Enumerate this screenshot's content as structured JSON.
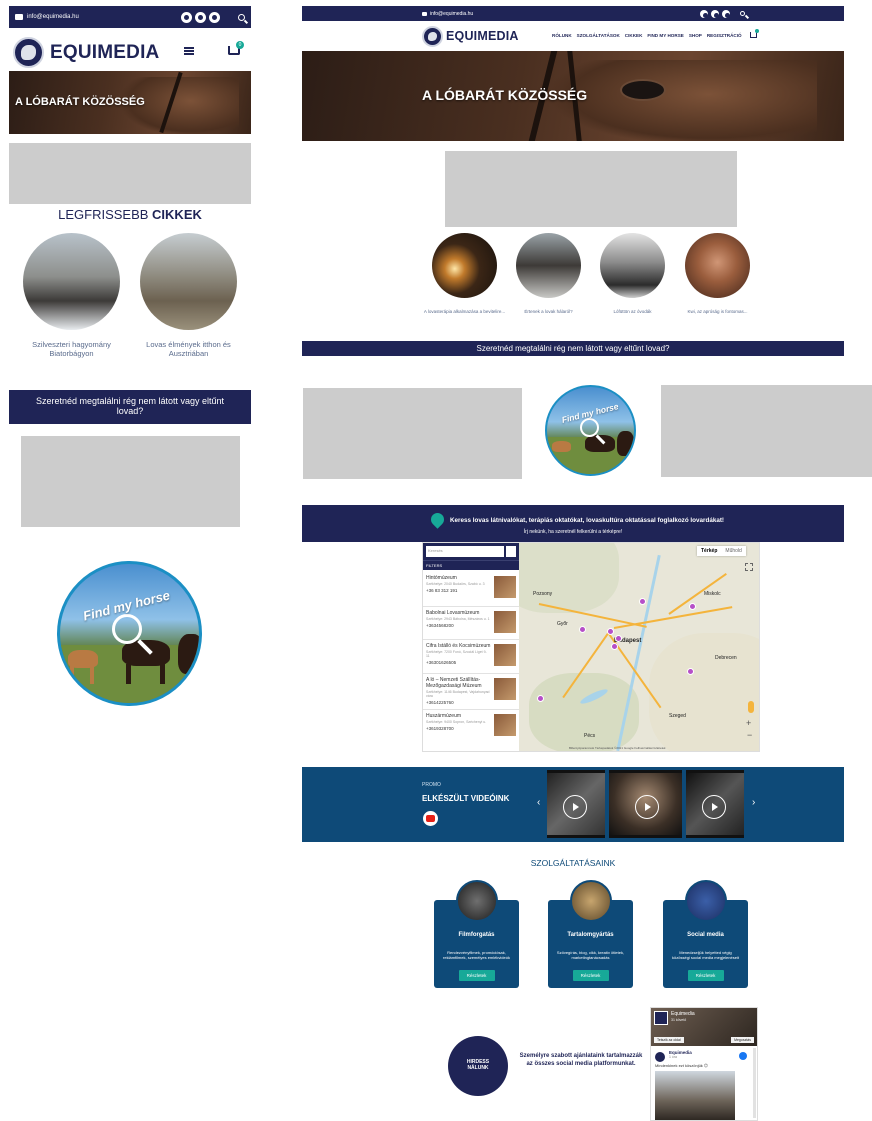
{
  "brand": {
    "email": "info@equimedia.hu",
    "name": "EQUIMEDIA"
  },
  "nav": {
    "items": [
      "RÓLUNK",
      "SZOLGÁLTATÁSOK",
      "CIKKEK",
      "FIND MY HORSE",
      "SHOP",
      "REGISZTRÁCIÓ"
    ],
    "cart_count": "0"
  },
  "hero": {
    "title": "A LÓBARÁT KÖZÖSSÉG"
  },
  "latest": {
    "title_light": "LEGFRISSEBB",
    "title_bold": "CIKKEK"
  },
  "mobile_articles": [
    {
      "caption": "Szilveszteri hagyomány Biatorbágyon"
    },
    {
      "caption": "Lovas élmények itthon és Ausztriában"
    }
  ],
  "desktop_articles": [
    {
      "caption": "A lovasterápia alkalmazása a bevitelire..."
    },
    {
      "caption": "Értenek a lovak hálaról?"
    },
    {
      "caption": "Lófüttön az óvodák"
    },
    {
      "caption": "Kwi, az apróság is fontomas..."
    }
  ],
  "lost_horse": {
    "text": "Szeretnéd megtalálni rég nem látott vagy eltűnt lovad?"
  },
  "find_my_horse": {
    "label": "Find my horse"
  },
  "map_section": {
    "heading": "Keress lovas látnivalókat, terápiás oktatókat, lovaskultúra oktatással foglalkozó lovardákat!",
    "subheading": "Írj nekünk, ha szeretnél felkerülni a térképre!",
    "search_placeholder": "Keresés",
    "filters_label": "FILTERS",
    "map_tab": "Térkép",
    "satellite_tab": "Műhold",
    "places": [
      {
        "name": "Hintómúzeum",
        "address": "Székhelye: 2040 Budaörs, Szabó u. 3",
        "phone": "+36 83 312 191"
      },
      {
        "name": "Babolnai Lovasmúzeum",
        "address": "Székhelye: 2943 Bábolna, Mészáros u. 1",
        "phone": "+3634568200"
      },
      {
        "name": "Cifra Istálló és Kocsimúzeum",
        "address": "Székhelye: 7200 Fonó, Szociál Liget 9-11",
        "phone": "+36301626505"
      },
      {
        "name": "A ló – Nemzeti Szállítás- Mezőgazdasági Múzeum",
        "address": "Székhelye: 1146 Budapest, Vajdahunyad vára",
        "phone": "+3614225760"
      },
      {
        "name": "Huszármúzeum",
        "address": "Székhelye: 9400 Sopron, Széchenyi u.",
        "phone": "+3619328700"
      }
    ],
    "cities": [
      "Pozsony",
      "Budapest",
      "Miskolc",
      "Debrecen",
      "Szeged",
      "Pécs",
      "Győr"
    ],
    "footer_note": "Billentyűparancsok   Térképadatok ©2021 Google   Felhasználási feltételek"
  },
  "videos": {
    "promo": "PROMO",
    "title": "ELKÉSZÜLT VIDEÓINK"
  },
  "services": {
    "title": "SZOLGÁLTATÁSAINK",
    "cards": [
      {
        "title": "Filmforgatás",
        "desc": "Rendezvényfilmek, promóciósak, reklámfilmek, személyes emlékvideók",
        "button": "Részletek"
      },
      {
        "title": "Tartalomgyártás",
        "desc": "Szövegírás, blog, cikk, kreatív ötletek, marketingtanácsadás",
        "button": "Részletek"
      },
      {
        "title": "Social media",
        "desc": "Menedzseljük helyetted végig közösségi social media megjelenéseit",
        "button": "Részletek"
      }
    ]
  },
  "advertise": {
    "badge": "HIRDESS NÁLUNK",
    "text": "Személyre szabott ajánlataink tartalmazzák az összes social media platformunkat."
  },
  "facebook": {
    "page": "Equimedia",
    "followers": "31 követő",
    "follow": "Tetszik az oldal",
    "share": "Megosztás",
    "post_author": "Equimedia",
    "post_time": "1 óra",
    "post_text": "Mindenkinek ezt köszönjük 😊"
  },
  "colors": {
    "navy": "#1f2456",
    "blue": "#0e4a78",
    "teal": "#17a998"
  }
}
